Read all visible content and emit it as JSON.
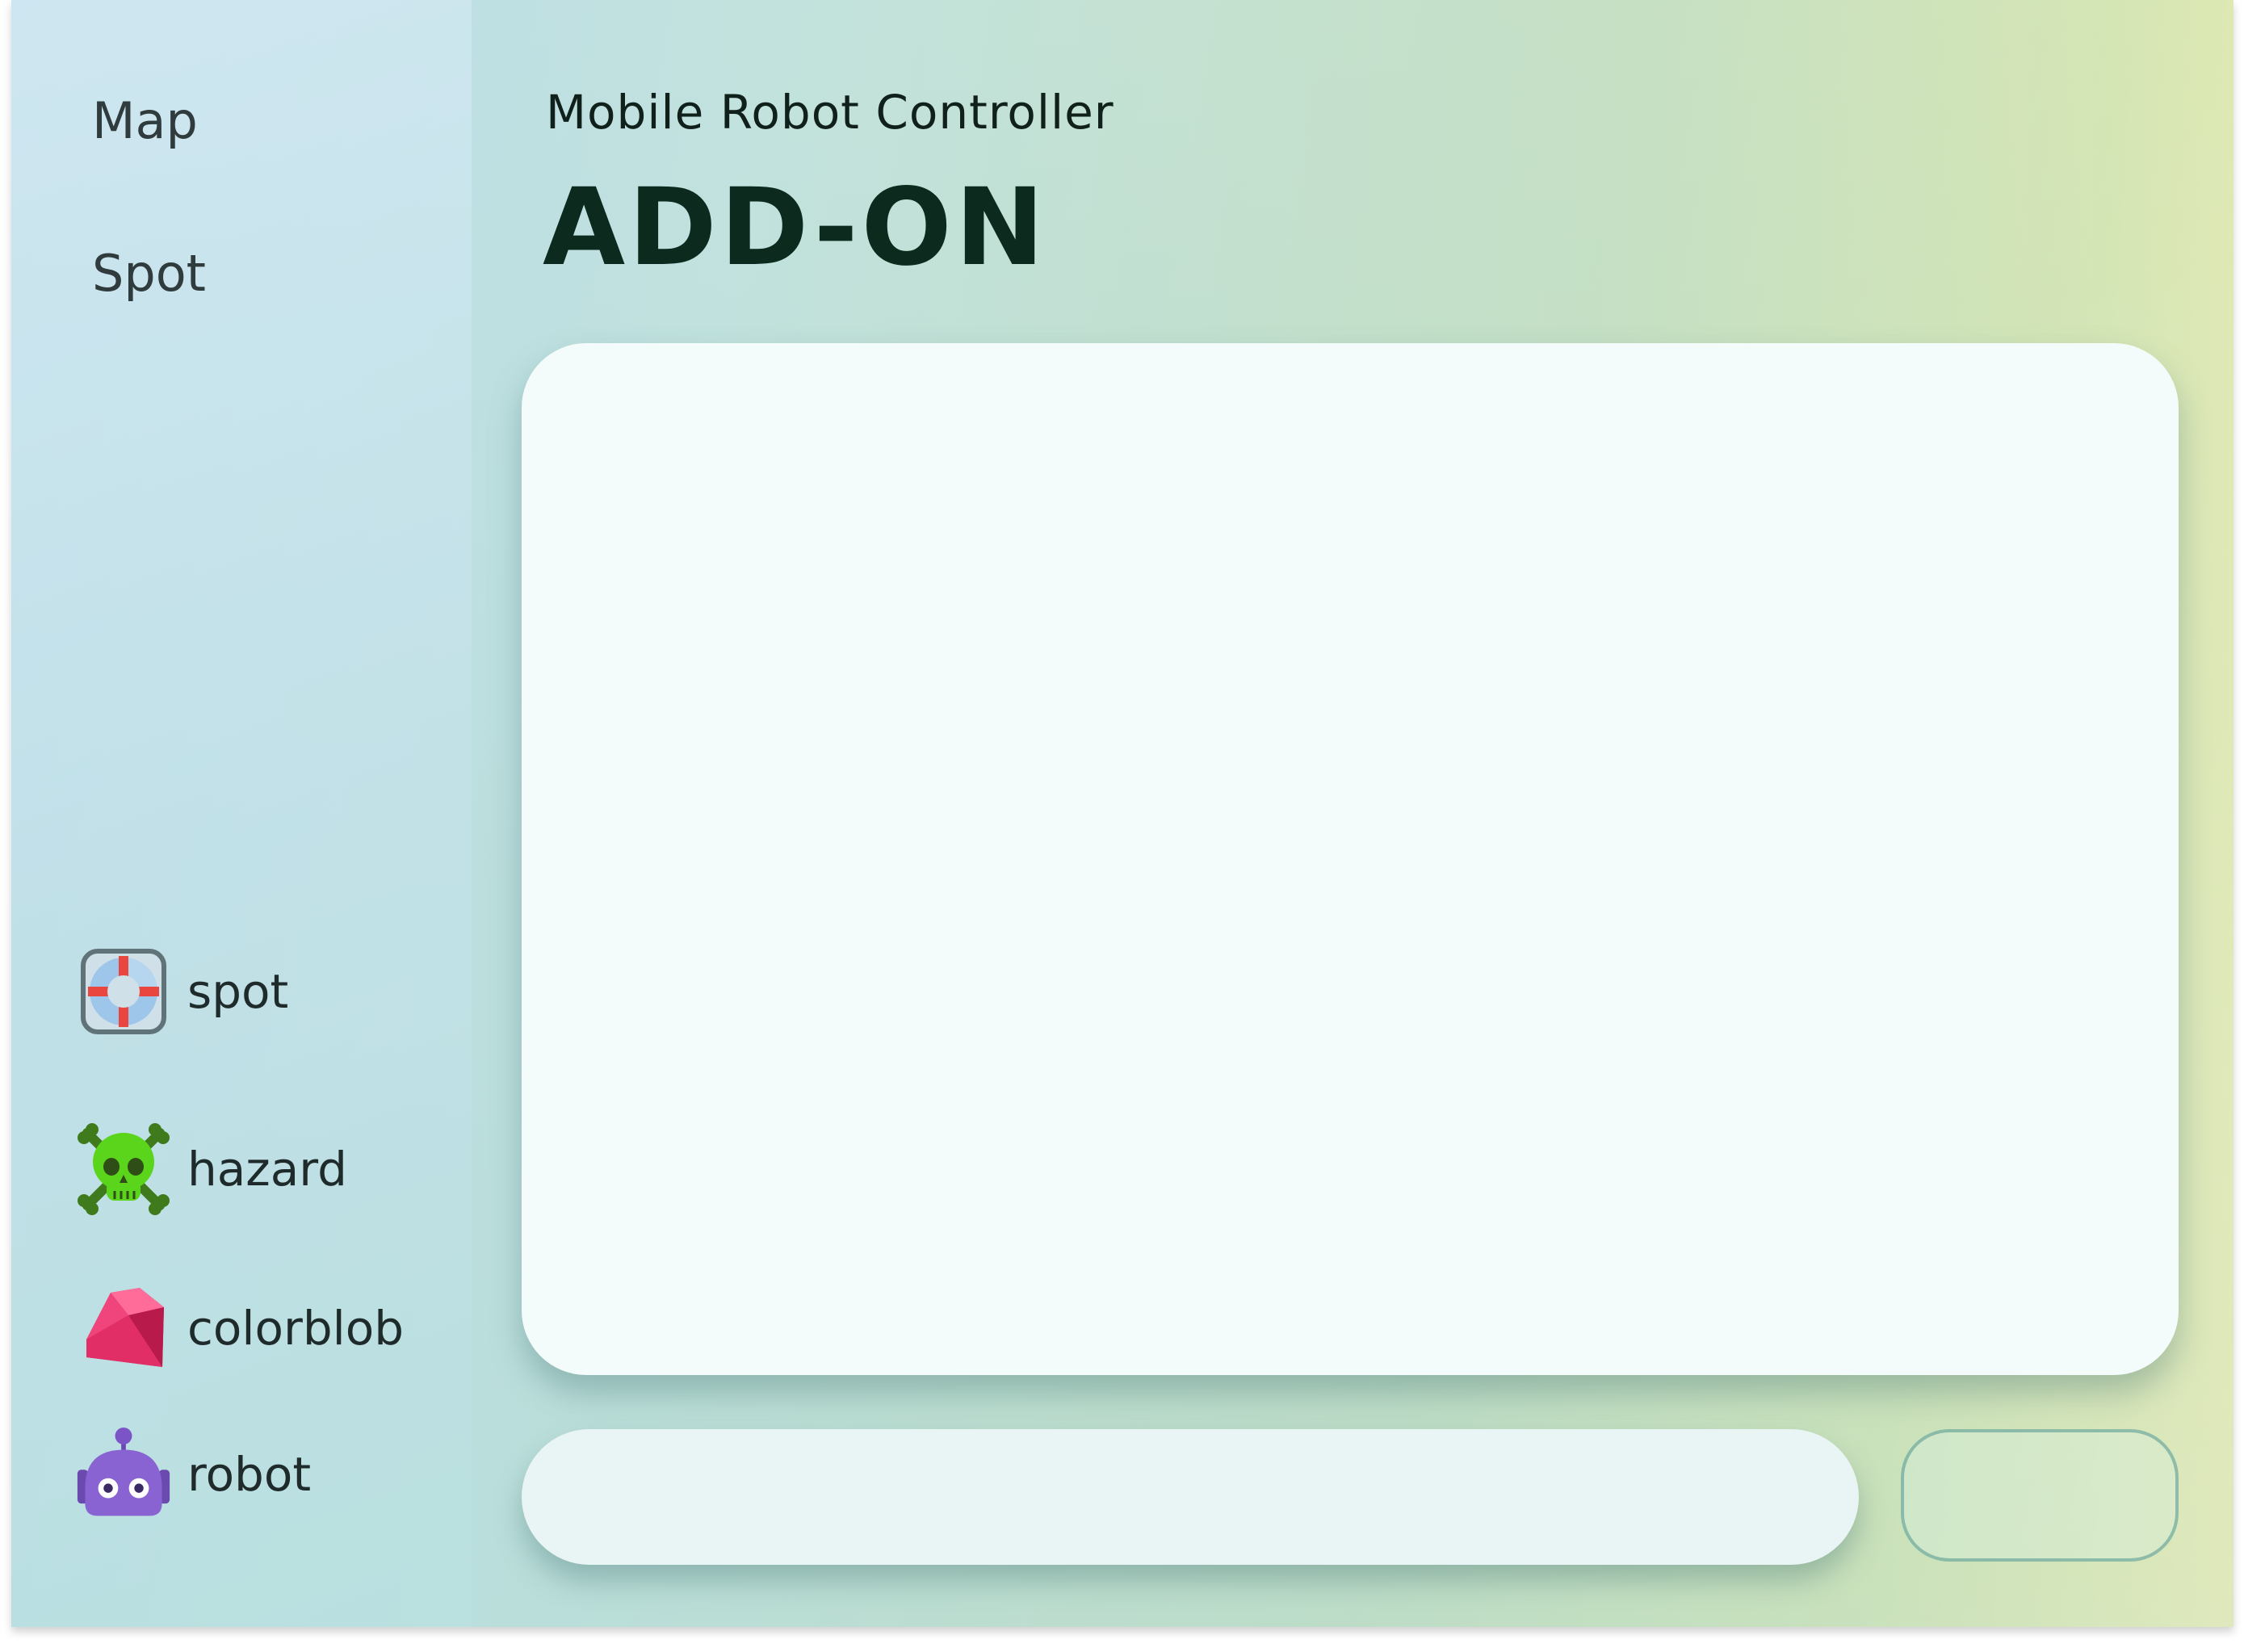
{
  "sidebar": {
    "nav": [
      {
        "label": "Map"
      },
      {
        "label": "Spot"
      }
    ],
    "tools": [
      {
        "label": "spot",
        "icon": "lifebuoy-icon"
      },
      {
        "label": "hazard",
        "icon": "skull-crossbones-icon"
      },
      {
        "label": "colorblob",
        "icon": "gem-icon"
      },
      {
        "label": "robot",
        "icon": "robot-icon"
      }
    ]
  },
  "header": {
    "subtitle": "Mobile Robot Controller",
    "title": "ADD-ON"
  },
  "input": {
    "value": "",
    "placeholder": ""
  },
  "send_button": {
    "label": ""
  },
  "colors": {
    "title": "#0c2a1e",
    "panel": "#f4fcfb",
    "input": "#e9f5f4",
    "button_border": "#5a968c"
  }
}
